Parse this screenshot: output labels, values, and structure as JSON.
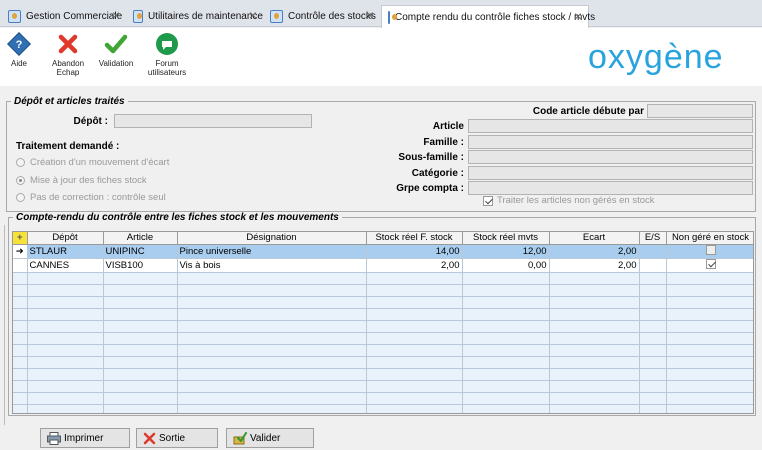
{
  "tabs": [
    {
      "label": "Gestion Commerciale"
    },
    {
      "label": "Utilitaires de maintenance"
    },
    {
      "label": "Contrôle des stocks"
    },
    {
      "label": "Compte rendu du contrôle fiches stock / mvts"
    }
  ],
  "toolbar": {
    "aide": "Aide",
    "abandon_1": "Abandon",
    "abandon_2": "Echap",
    "validation": "Validation",
    "forum_1": "Forum",
    "forum_2": "utilisateurs"
  },
  "logo": "oxygène",
  "depot_section": {
    "legend": "Dépôt et articles traités",
    "depot_label": "Dépôt :",
    "code_label": "Code article débute par",
    "article_label": "Article",
    "famille_label": "Famille :",
    "sous_famille_label": "Sous-famille :",
    "categorie_label": "Catégorie :",
    "grpe_label": "Grpe compta :",
    "traitement_label": "Traitement demandé :",
    "radio_creation": "Création d'un mouvement d'écart",
    "radio_maj": "Mise à jour des fiches stock",
    "radio_pas": "Pas de correction : contrôle seul",
    "traiter_label": "Traiter les articles non gérés en stock"
  },
  "compte_rendu": {
    "legend": "Compte-rendu du contrôle entre les fiches stock et les mouvements",
    "columns": [
      "Dépôt",
      "Article",
      "Désignation",
      "Stock réel F. stock",
      "Stock réel mvts",
      "Ecart",
      "E/S",
      "Non géré en stock"
    ],
    "rows": [
      {
        "depot": "STLAUR",
        "article": "UNIPINC",
        "designation": "Pince universelle",
        "stock_f": "14,00",
        "stock_m": "12,00",
        "ecart": "2,00",
        "es": "",
        "non_gere": false
      },
      {
        "depot": "CANNES",
        "article": "VISB100",
        "designation": "Vis à  bois",
        "stock_f": "2,00",
        "stock_m": "0,00",
        "ecart": "2,00",
        "es": "",
        "non_gere": true
      }
    ]
  },
  "buttons": {
    "imprimer": "Imprimer",
    "sortie": "Sortie",
    "valider": "Valider"
  },
  "colors": {
    "accent": "#29a3dd",
    "selected_row": "#a8cdee"
  }
}
